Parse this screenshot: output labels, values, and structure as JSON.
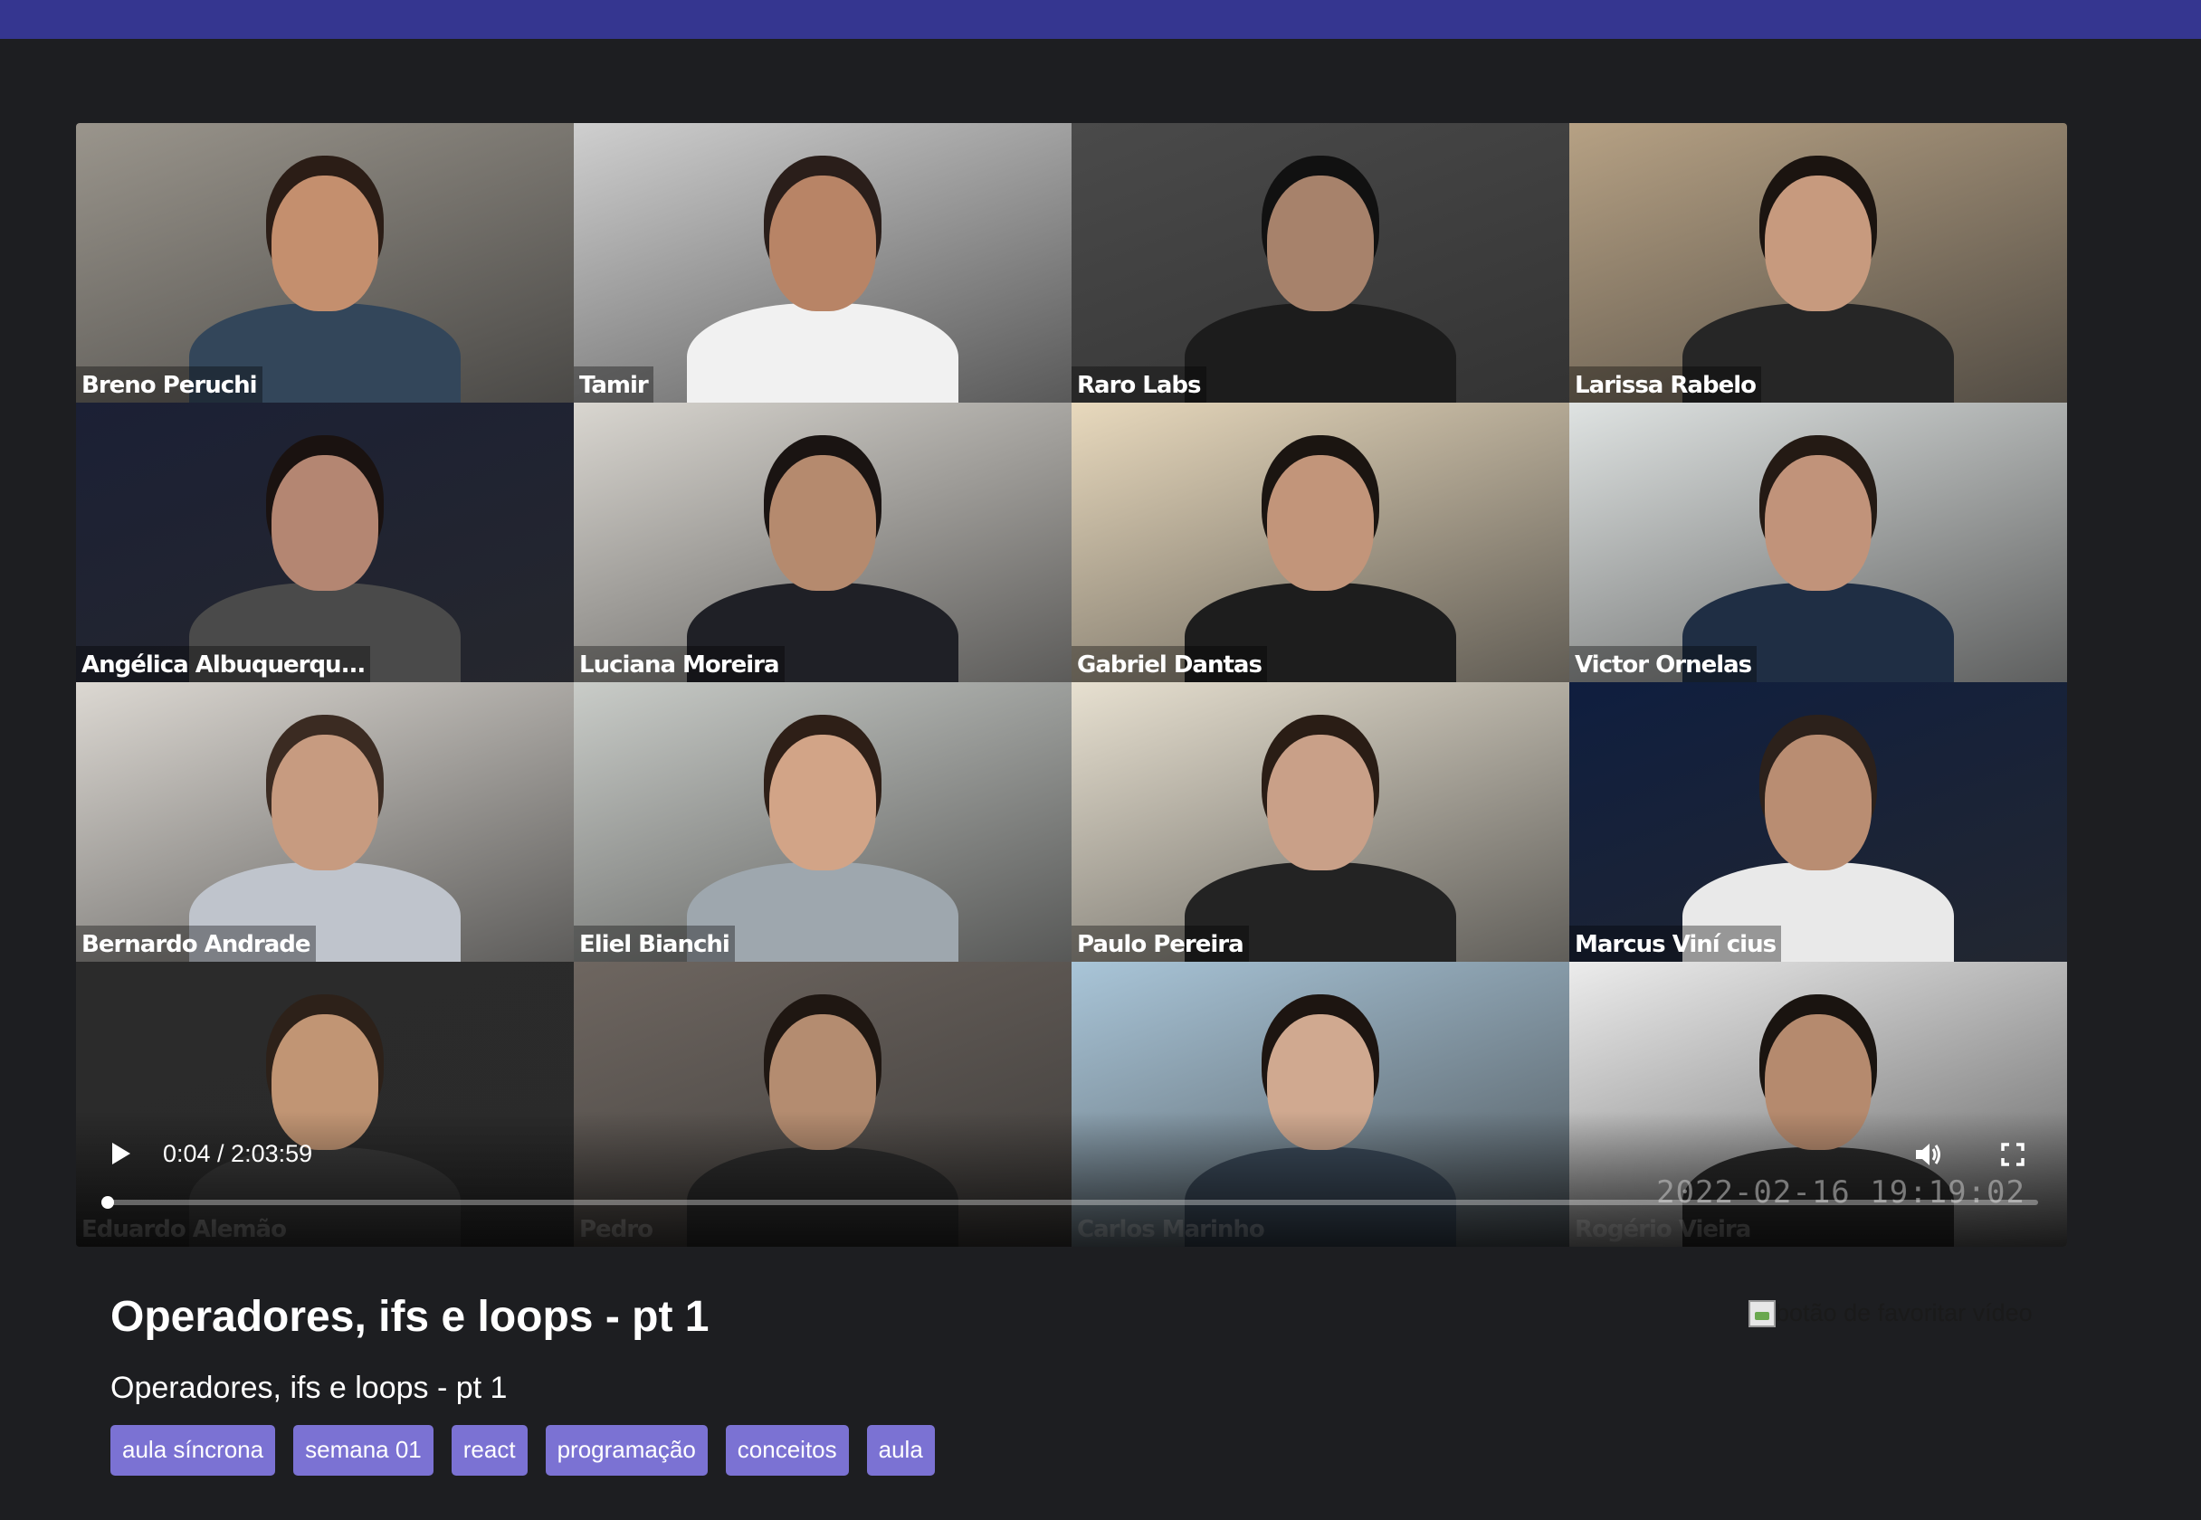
{
  "video": {
    "current_time": "0:04",
    "duration": "2:03:59",
    "time_display": "0:04 / 2:03:59",
    "progress": 0.0005,
    "watermark_timestamp": "2022-02-16  19:19:02",
    "participants": [
      {
        "name": "Breno Peruchi",
        "bg": "#9a958c",
        "skin": "#c48f6e",
        "shirt": "#33465a",
        "hair": "#2b1d16"
      },
      {
        "name": "Tamir",
        "bg": "#cfcfcf",
        "skin": "#b88466",
        "shirt": "#f1f1f1",
        "hair": "#2a1e1a"
      },
      {
        "name": "Raro Labs",
        "bg": "#4a4a4a",
        "skin": "#a7826b",
        "shirt": "#1c1c1c",
        "hair": "#111111"
      },
      {
        "name": "Larissa Rabelo",
        "bg": "#b6a184",
        "skin": "#c79a7e",
        "shirt": "#262626",
        "hair": "#1b1410"
      },
      {
        "name": "Angélica Albuquerqu...",
        "bg": "#1b2035",
        "skin": "#b48672",
        "shirt": "#4a4a4a",
        "hair": "#1a1210"
      },
      {
        "name": "Luciana Moreira",
        "bg": "#d9d6d0",
        "skin": "#b58a6e",
        "shirt": "#1f2026",
        "hair": "#1a1412"
      },
      {
        "name": "Gabriel Dantas",
        "bg": "#e8d9bd",
        "skin": "#c2957a",
        "shirt": "#1d1d1d",
        "hair": "#1b1511"
      },
      {
        "name": "Victor Ornelas",
        "bg": "#dfe3e2",
        "skin": "#c1937a",
        "shirt": "#1f2e44",
        "hair": "#241a14"
      },
      {
        "name": "Bernardo Andrade",
        "bg": "#dcd8d2",
        "skin": "#c79b80",
        "shirt": "#bfc4cc",
        "hair": "#3b2b22"
      },
      {
        "name": "Eliel Bianchi",
        "bg": "#c9ccc8",
        "skin": "#d2a487",
        "shirt": "#9ea7ae",
        "hair": "#2e1f17"
      },
      {
        "name": "Paulo Pereira",
        "bg": "#e7e0d0",
        "skin": "#c9a088",
        "shirt": "#232323",
        "hair": "#2a1d15"
      },
      {
        "name": "Marcus Viní cius",
        "bg": "#0f1e3f",
        "skin": "#b98d72",
        "shirt": "#e9e9e9",
        "hair": "#2c211b"
      },
      {
        "name": "Eduardo Alemão",
        "bg": "#2b2b2b",
        "skin": "#c19574",
        "shirt": "#3a3a3a",
        "hair": "#2d2119"
      },
      {
        "name": "Pedro",
        "bg": "#6e6660",
        "skin": "#b48c70",
        "shirt": "#2e2e2e",
        "hair": "#1f1712"
      },
      {
        "name": "Carlos Marinho",
        "bg": "#a9c5d8",
        "skin": "#d0a990",
        "shirt": "#3b4a5a",
        "hair": "#1d1511"
      },
      {
        "name": "Rogério Vieira",
        "bg": "#ececec",
        "skin": "#b58a6e",
        "shirt": "#2a2a2a",
        "hair": "#1a1410"
      }
    ]
  },
  "content": {
    "title": "Operadores, ifs e loops - pt 1",
    "description": "Operadores, ifs e loops - pt 1",
    "favorite_alt": "botão de favoritar vídeo",
    "tags": [
      "aula síncrona",
      "semana 01",
      "react",
      "programação",
      "conceitos",
      "aula"
    ]
  },
  "colors": {
    "top_bar": "#353690",
    "page_bg": "#1d1e21",
    "tag_bg": "#7b72d3"
  },
  "icons": {
    "play": "play-icon",
    "volume": "volume-icon",
    "fullscreen": "fullscreen-icon",
    "more": "more-options-icon"
  }
}
